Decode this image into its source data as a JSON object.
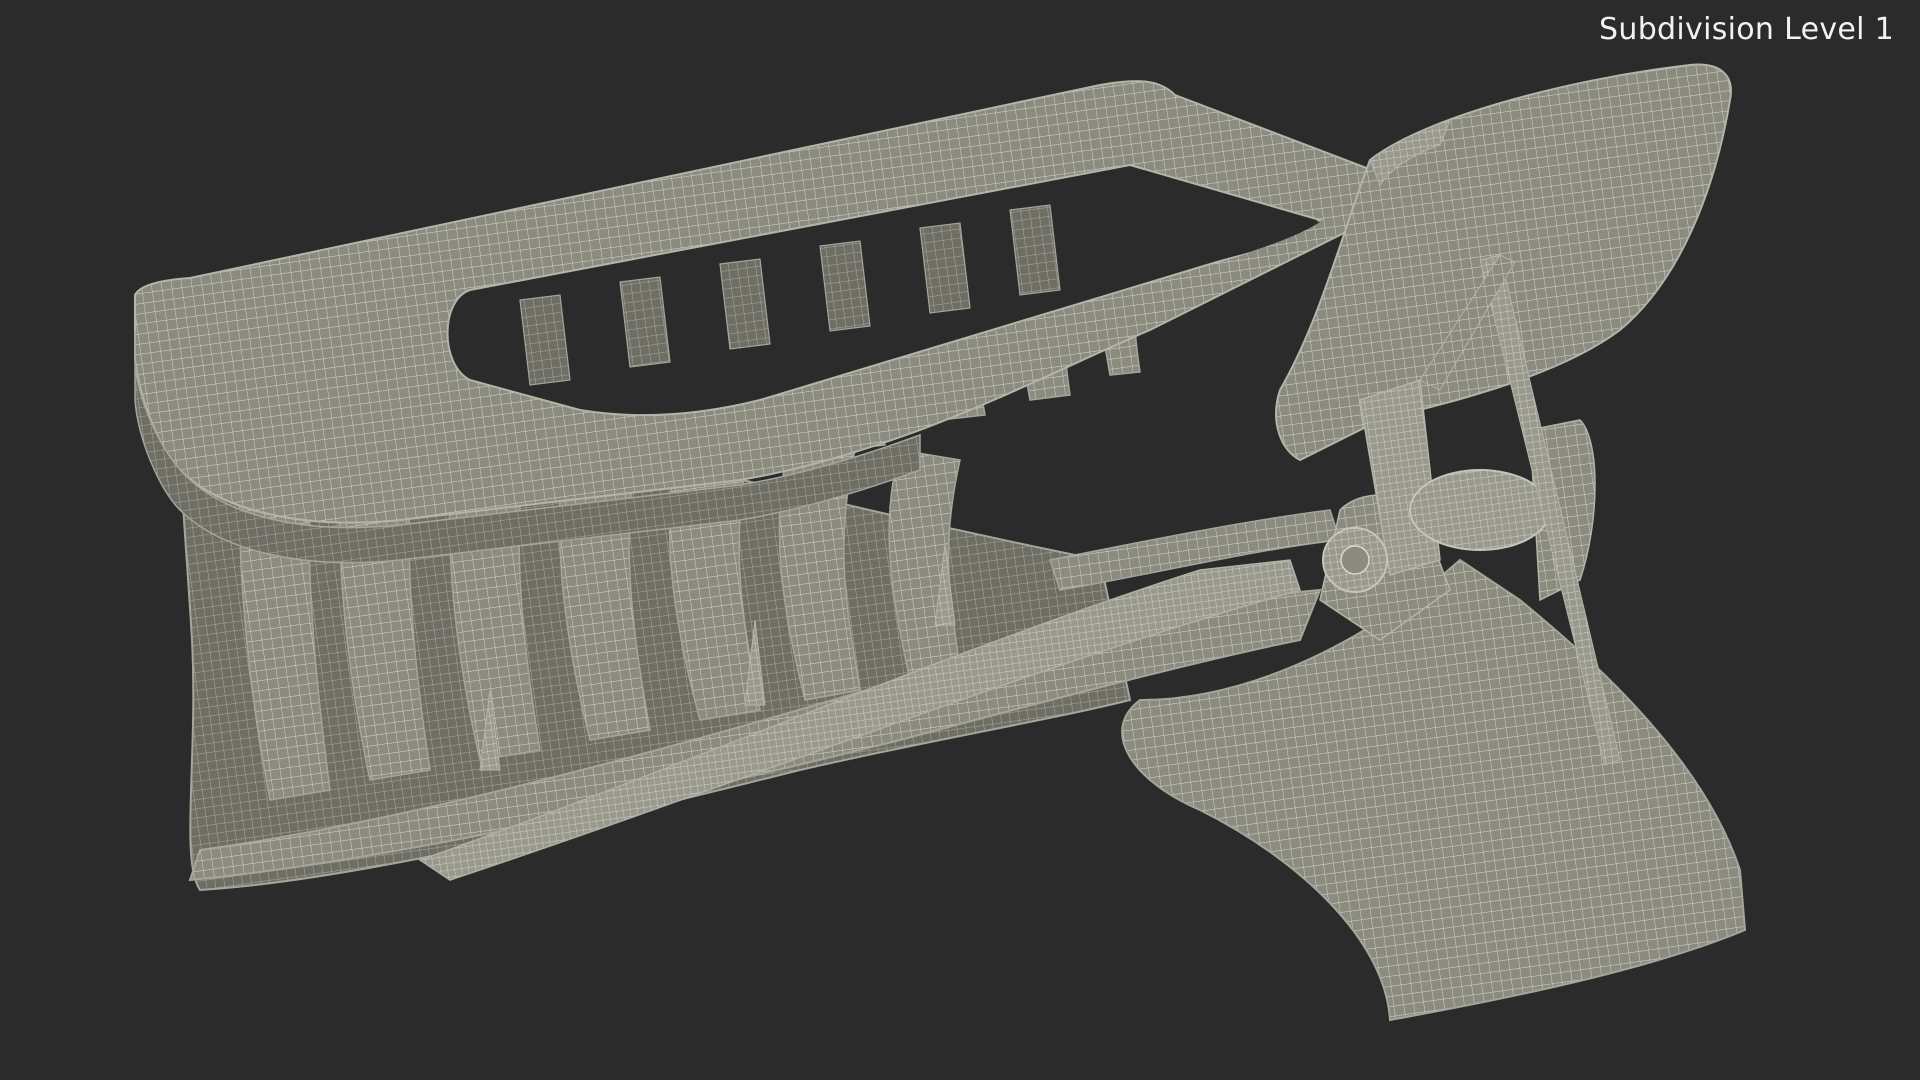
{
  "viewport": {
    "background_color": "#2b2b2b",
    "overlay_label": "Subdivision Level 1",
    "overlay_text_color": "#f2f2f2"
  },
  "model": {
    "surface_color": "#8c8b80",
    "wire_color": "#d8d8cc",
    "shadow_color": "#6e6d64"
  }
}
